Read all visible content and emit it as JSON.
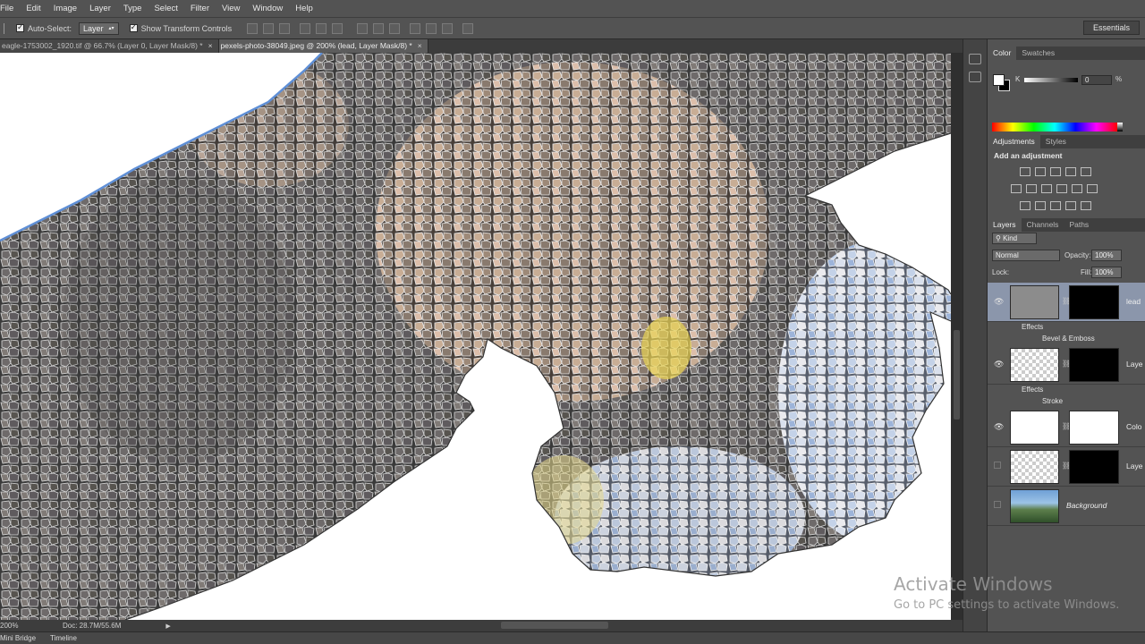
{
  "menu": [
    "File",
    "Edit",
    "Image",
    "Layer",
    "Type",
    "Select",
    "Filter",
    "View",
    "Window",
    "Help"
  ],
  "options": {
    "auto_select_label": "Auto-Select:",
    "auto_select_value": "Layer",
    "show_transform_label": "Show Transform Controls",
    "workspace": "Essentials"
  },
  "tabs": [
    {
      "label": "eagle-1753002_1920.tif @ 66.7% (Layer 0, Layer Mask/8) *",
      "close": "×",
      "active": false
    },
    {
      "label": "pexels-photo-38049.jpeg @ 200% (lead, Layer Mask/8) *",
      "close": "×",
      "active": true
    }
  ],
  "status": {
    "zoom": "200%",
    "doc": "Doc: 28.7M/55.6M"
  },
  "bottom_tabs": [
    "Mini Bridge",
    "Timeline"
  ],
  "color_panel": {
    "tabs": [
      "Color",
      "Swatches"
    ],
    "channel": "K",
    "value": "0",
    "unit": "%",
    "fg_color": "#ffffff",
    "bg_color": "#000000"
  },
  "adjustments": {
    "tabs": [
      "Adjustments",
      "Styles"
    ],
    "title": "Add an adjustment"
  },
  "layers": {
    "tabs": [
      "Layers",
      "Channels",
      "Paths"
    ],
    "filter": "Kind",
    "blend_mode": "Normal",
    "opacity_label": "Opacity:",
    "opacity": "100%",
    "lock_label": "Lock:",
    "fill_label": "Fill:",
    "fill": "100%",
    "items": [
      {
        "name": "lead",
        "selected": true,
        "visible": true,
        "effects_label": "Effects",
        "effect": "Bevel & Emboss"
      },
      {
        "name": "Laye",
        "selected": false,
        "visible": true,
        "effects_label": "Effects",
        "effect": "Stroke"
      },
      {
        "name": "Colo",
        "selected": false,
        "visible": true
      },
      {
        "name": "Laye",
        "selected": false,
        "visible": false
      },
      {
        "name": "Background",
        "selected": false,
        "visible": false
      }
    ]
  },
  "watermark": {
    "title": "Activate Windows",
    "subtitle": "Go to PC settings to activate Windows."
  }
}
